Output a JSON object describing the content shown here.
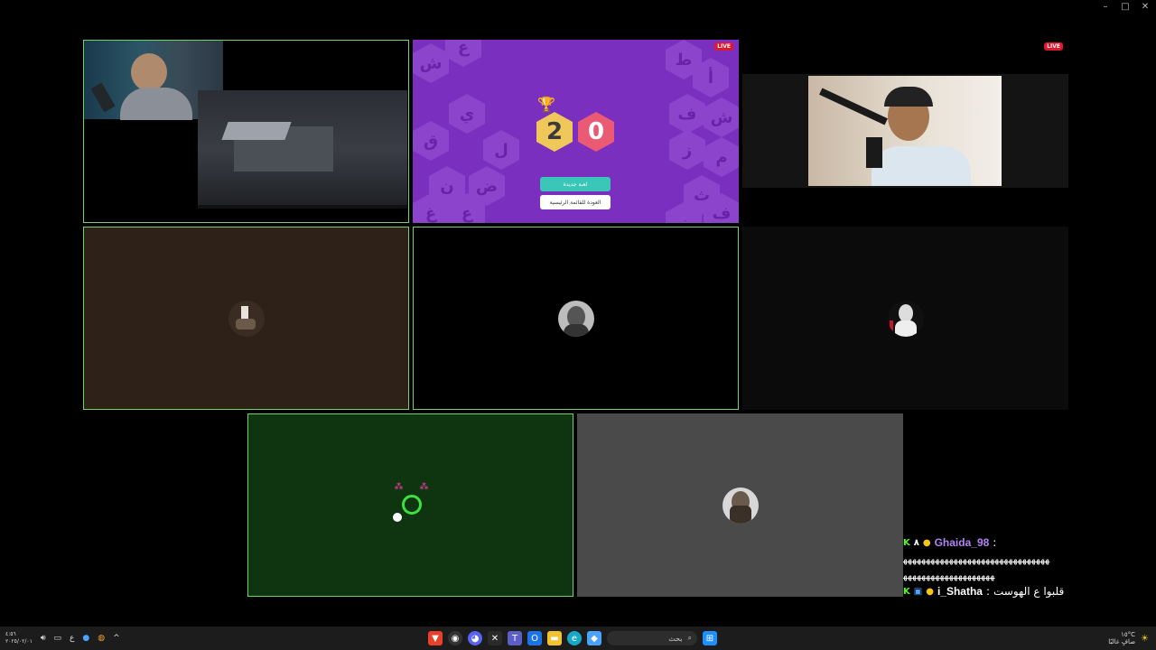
{
  "window": {
    "minimize": "–",
    "maximize": "□",
    "close": "✕"
  },
  "live_badge": "LIVE",
  "game": {
    "score_left": "2",
    "score_right": "0",
    "new_game_label": "لعبة جديدة",
    "main_menu_label": "العودة للقائمة الرئيسية",
    "bg_letters": [
      "ش",
      "ع",
      "ي",
      "ق",
      "ل",
      "ن",
      "ض",
      "غ",
      "ع",
      "ط",
      "أ",
      "ف",
      "ش",
      "ز",
      "م",
      "ث",
      "ف",
      "ز"
    ]
  },
  "chat": {
    "messages": [
      {
        "username": "Ghaida_98",
        "separator": ":",
        "text": "ﻬﻬﻬﻬﻬﻬﻬﻬﻬﻬﻬﻬﻬﻬﻬﻬﻬﻬﻬﻬﻬﻬﻬﻬﻬﻬﻬﻬﻬﻬﻬﻬ",
        "text2": "ﻬﻬﻬﻬﻬﻬﻬﻬﻬﻬﻬﻬﻬﻬﻬﻬﻬﻬﻬﻬ",
        "color": "#b383f2"
      },
      {
        "username": "i_Shatha",
        "separator": ":",
        "text": "قلبوا ع الهوست",
        "color": "#ffffff"
      }
    ]
  },
  "taskbar": {
    "lang": "ع",
    "clock_time": "٤:٥٦",
    "clock_date": "٢٠٢٥/٠٢/٠١",
    "search_placeholder": "بحث",
    "weather_temp": "١٥°C",
    "weather_desc": "صافٍ غالبًا"
  },
  "colors": {
    "speaking_border": "#6fd36f",
    "game_bg": "#7b2fbf",
    "live": "#e0182f"
  }
}
